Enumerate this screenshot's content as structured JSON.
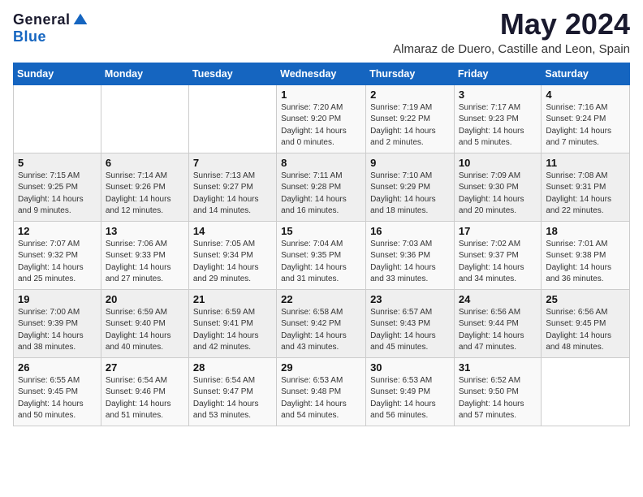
{
  "header": {
    "logo_general": "General",
    "logo_blue": "Blue",
    "month_year": "May 2024",
    "location": "Almaraz de Duero, Castille and Leon, Spain"
  },
  "days_of_week": [
    "Sunday",
    "Monday",
    "Tuesday",
    "Wednesday",
    "Thursday",
    "Friday",
    "Saturday"
  ],
  "weeks": [
    [
      {
        "day": "",
        "sunrise": "",
        "sunset": "",
        "daylight": ""
      },
      {
        "day": "",
        "sunrise": "",
        "sunset": "",
        "daylight": ""
      },
      {
        "day": "",
        "sunrise": "",
        "sunset": "",
        "daylight": ""
      },
      {
        "day": "1",
        "sunrise": "Sunrise: 7:20 AM",
        "sunset": "Sunset: 9:20 PM",
        "daylight": "Daylight: 14 hours and 0 minutes."
      },
      {
        "day": "2",
        "sunrise": "Sunrise: 7:19 AM",
        "sunset": "Sunset: 9:22 PM",
        "daylight": "Daylight: 14 hours and 2 minutes."
      },
      {
        "day": "3",
        "sunrise": "Sunrise: 7:17 AM",
        "sunset": "Sunset: 9:23 PM",
        "daylight": "Daylight: 14 hours and 5 minutes."
      },
      {
        "day": "4",
        "sunrise": "Sunrise: 7:16 AM",
        "sunset": "Sunset: 9:24 PM",
        "daylight": "Daylight: 14 hours and 7 minutes."
      }
    ],
    [
      {
        "day": "5",
        "sunrise": "Sunrise: 7:15 AM",
        "sunset": "Sunset: 9:25 PM",
        "daylight": "Daylight: 14 hours and 9 minutes."
      },
      {
        "day": "6",
        "sunrise": "Sunrise: 7:14 AM",
        "sunset": "Sunset: 9:26 PM",
        "daylight": "Daylight: 14 hours and 12 minutes."
      },
      {
        "day": "7",
        "sunrise": "Sunrise: 7:13 AM",
        "sunset": "Sunset: 9:27 PM",
        "daylight": "Daylight: 14 hours and 14 minutes."
      },
      {
        "day": "8",
        "sunrise": "Sunrise: 7:11 AM",
        "sunset": "Sunset: 9:28 PM",
        "daylight": "Daylight: 14 hours and 16 minutes."
      },
      {
        "day": "9",
        "sunrise": "Sunrise: 7:10 AM",
        "sunset": "Sunset: 9:29 PM",
        "daylight": "Daylight: 14 hours and 18 minutes."
      },
      {
        "day": "10",
        "sunrise": "Sunrise: 7:09 AM",
        "sunset": "Sunset: 9:30 PM",
        "daylight": "Daylight: 14 hours and 20 minutes."
      },
      {
        "day": "11",
        "sunrise": "Sunrise: 7:08 AM",
        "sunset": "Sunset: 9:31 PM",
        "daylight": "Daylight: 14 hours and 22 minutes."
      }
    ],
    [
      {
        "day": "12",
        "sunrise": "Sunrise: 7:07 AM",
        "sunset": "Sunset: 9:32 PM",
        "daylight": "Daylight: 14 hours and 25 minutes."
      },
      {
        "day": "13",
        "sunrise": "Sunrise: 7:06 AM",
        "sunset": "Sunset: 9:33 PM",
        "daylight": "Daylight: 14 hours and 27 minutes."
      },
      {
        "day": "14",
        "sunrise": "Sunrise: 7:05 AM",
        "sunset": "Sunset: 9:34 PM",
        "daylight": "Daylight: 14 hours and 29 minutes."
      },
      {
        "day": "15",
        "sunrise": "Sunrise: 7:04 AM",
        "sunset": "Sunset: 9:35 PM",
        "daylight": "Daylight: 14 hours and 31 minutes."
      },
      {
        "day": "16",
        "sunrise": "Sunrise: 7:03 AM",
        "sunset": "Sunset: 9:36 PM",
        "daylight": "Daylight: 14 hours and 33 minutes."
      },
      {
        "day": "17",
        "sunrise": "Sunrise: 7:02 AM",
        "sunset": "Sunset: 9:37 PM",
        "daylight": "Daylight: 14 hours and 34 minutes."
      },
      {
        "day": "18",
        "sunrise": "Sunrise: 7:01 AM",
        "sunset": "Sunset: 9:38 PM",
        "daylight": "Daylight: 14 hours and 36 minutes."
      }
    ],
    [
      {
        "day": "19",
        "sunrise": "Sunrise: 7:00 AM",
        "sunset": "Sunset: 9:39 PM",
        "daylight": "Daylight: 14 hours and 38 minutes."
      },
      {
        "day": "20",
        "sunrise": "Sunrise: 6:59 AM",
        "sunset": "Sunset: 9:40 PM",
        "daylight": "Daylight: 14 hours and 40 minutes."
      },
      {
        "day": "21",
        "sunrise": "Sunrise: 6:59 AM",
        "sunset": "Sunset: 9:41 PM",
        "daylight": "Daylight: 14 hours and 42 minutes."
      },
      {
        "day": "22",
        "sunrise": "Sunrise: 6:58 AM",
        "sunset": "Sunset: 9:42 PM",
        "daylight": "Daylight: 14 hours and 43 minutes."
      },
      {
        "day": "23",
        "sunrise": "Sunrise: 6:57 AM",
        "sunset": "Sunset: 9:43 PM",
        "daylight": "Daylight: 14 hours and 45 minutes."
      },
      {
        "day": "24",
        "sunrise": "Sunrise: 6:56 AM",
        "sunset": "Sunset: 9:44 PM",
        "daylight": "Daylight: 14 hours and 47 minutes."
      },
      {
        "day": "25",
        "sunrise": "Sunrise: 6:56 AM",
        "sunset": "Sunset: 9:45 PM",
        "daylight": "Daylight: 14 hours and 48 minutes."
      }
    ],
    [
      {
        "day": "26",
        "sunrise": "Sunrise: 6:55 AM",
        "sunset": "Sunset: 9:45 PM",
        "daylight": "Daylight: 14 hours and 50 minutes."
      },
      {
        "day": "27",
        "sunrise": "Sunrise: 6:54 AM",
        "sunset": "Sunset: 9:46 PM",
        "daylight": "Daylight: 14 hours and 51 minutes."
      },
      {
        "day": "28",
        "sunrise": "Sunrise: 6:54 AM",
        "sunset": "Sunset: 9:47 PM",
        "daylight": "Daylight: 14 hours and 53 minutes."
      },
      {
        "day": "29",
        "sunrise": "Sunrise: 6:53 AM",
        "sunset": "Sunset: 9:48 PM",
        "daylight": "Daylight: 14 hours and 54 minutes."
      },
      {
        "day": "30",
        "sunrise": "Sunrise: 6:53 AM",
        "sunset": "Sunset: 9:49 PM",
        "daylight": "Daylight: 14 hours and 56 minutes."
      },
      {
        "day": "31",
        "sunrise": "Sunrise: 6:52 AM",
        "sunset": "Sunset: 9:50 PM",
        "daylight": "Daylight: 14 hours and 57 minutes."
      },
      {
        "day": "",
        "sunrise": "",
        "sunset": "",
        "daylight": ""
      }
    ]
  ]
}
